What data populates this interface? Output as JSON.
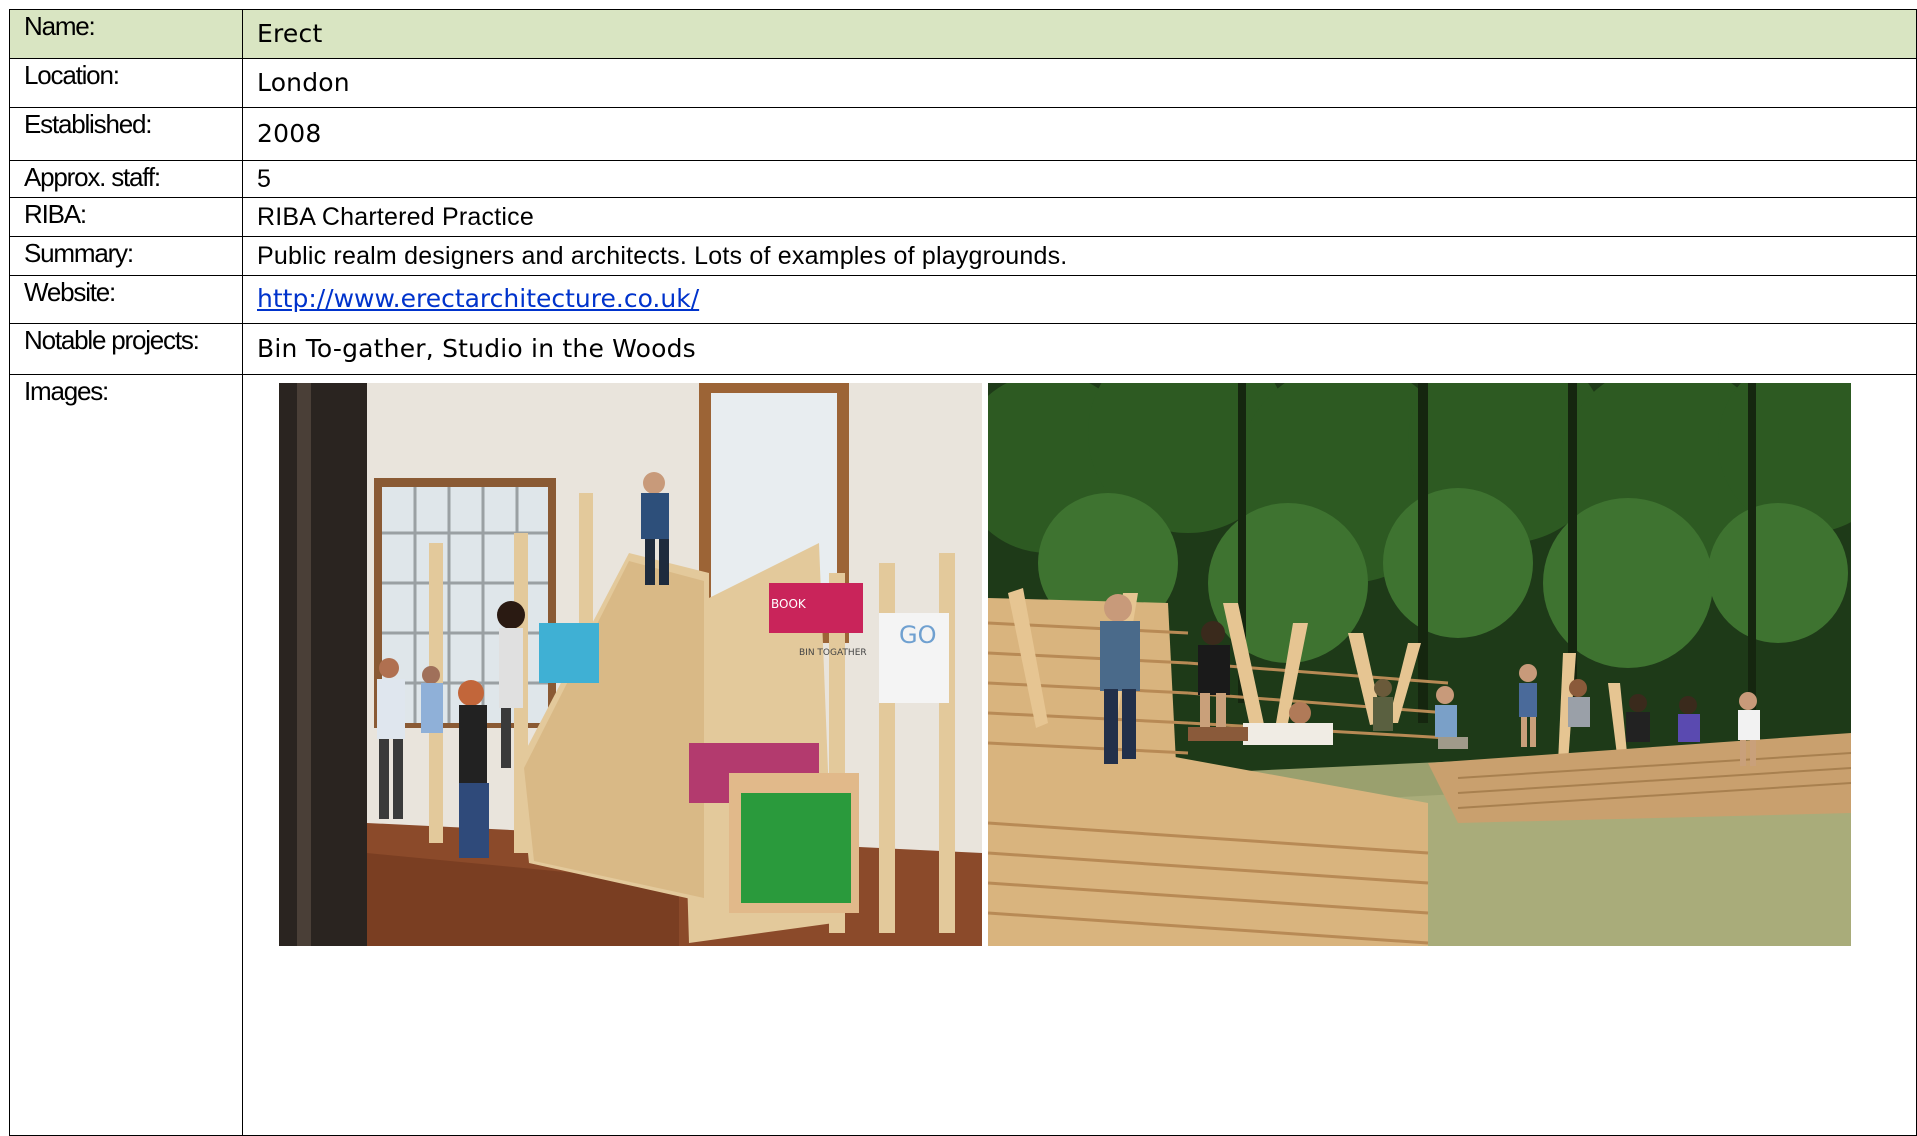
{
  "profile": {
    "rows": [
      {
        "label": "Name:",
        "value": "Erect"
      },
      {
        "label": "Location:",
        "value": "London"
      },
      {
        "label": "Established:",
        "value": "2008"
      },
      {
        "label": "Approx. staff:",
        "value": "5"
      },
      {
        "label": "RIBA:",
        "value": "RIBA Chartered Practice"
      },
      {
        "label": "Summary:",
        "value": "Public realm designers and architects. Lots of examples of playgrounds."
      },
      {
        "label": "Website:",
        "value": "http://www.erectarchitecture.co.uk/"
      },
      {
        "label": "Notable projects:",
        "value": "Bin To-gather, Studio in the Woods"
      },
      {
        "label": "Images:"
      }
    ]
  },
  "images": {
    "bin_to_gather": {
      "sign_text": "GO",
      "book_text": "BOOK",
      "panel_text": "BIN TOGATHER"
    }
  },
  "colors": {
    "header_bg": "#d9e5c2",
    "border": "#000000",
    "link": "#0033cc"
  }
}
